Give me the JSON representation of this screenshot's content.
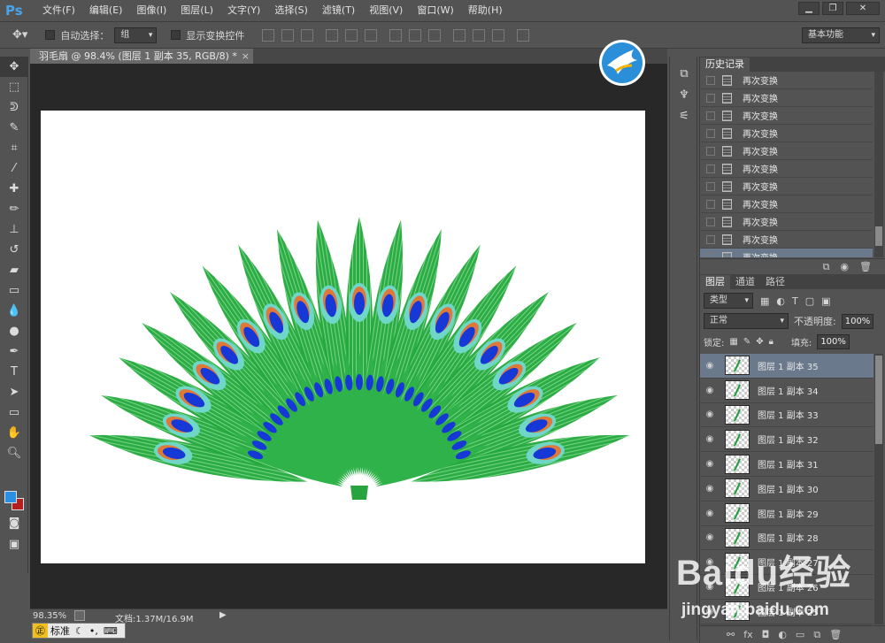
{
  "app": {
    "logo": "Ps",
    "window_buttons": [
      "▁",
      "❐",
      "✕"
    ]
  },
  "menu": [
    "文件(F)",
    "编辑(E)",
    "图像(I)",
    "图层(L)",
    "文字(Y)",
    "选择(S)",
    "滤镜(T)",
    "视图(V)",
    "窗口(W)",
    "帮助(H)"
  ],
  "options": {
    "auto_select_label": "自动选择：",
    "auto_select_value": "组",
    "show_transform_label": "显示变换控件",
    "workspace": "基本功能"
  },
  "document": {
    "tab_title": "羽毛扇 @ 98.4% (图层 1 副本 35, RGB/8) *",
    "close": "×"
  },
  "status": {
    "zoom": "98.35%",
    "doc_info": "文档:1.37M/16.9M"
  },
  "ime": {
    "label": "标准"
  },
  "history": {
    "tabs": [
      "历史记录"
    ],
    "items": [
      "再次变换",
      "再次变换",
      "再次变换",
      "再次变换",
      "再次变换",
      "再次变换",
      "再次变换",
      "再次变换",
      "再次变换",
      "再次变换",
      "再次变换"
    ],
    "selected_index": 10
  },
  "layers": {
    "tabs": [
      "图层",
      "通道",
      "路径"
    ],
    "filter_kind": "类型",
    "blend_mode": "正常",
    "opacity_label": "不透明度:",
    "opacity": "100%",
    "lock_label": "锁定:",
    "fill_label": "填充:",
    "fill": "100%",
    "items": [
      "图层 1 副本 35",
      "图层 1 副本 34",
      "图层 1 副本 33",
      "图层 1 副本 32",
      "图层 1 副本 31",
      "图层 1 副本 30",
      "图层 1 副本 29",
      "图层 1 副本 28",
      "图层 1 副本 27",
      "图层 1 副本 26",
      "图层 1 副本 25"
    ],
    "selected_index": 0
  },
  "watermark": {
    "main": "Baidu经验",
    "sub": "jingyan.baidu.com"
  },
  "colors": {
    "foreground": "#2b8fe3",
    "background": "#b3201f",
    "feather_green": "#22a83c",
    "eye_blue": "#1538d6"
  }
}
